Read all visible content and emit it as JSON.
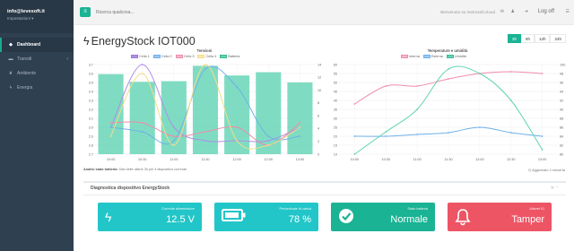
{
  "sidebar": {
    "profile_email": "info@levesoft.it",
    "profile_role": "Impostazioni ▾",
    "items": [
      {
        "label": "Dashboard",
        "icon": "dashboard-icon"
      },
      {
        "label": "Transiti",
        "icon": "car-icon"
      },
      {
        "label": "Ambiente",
        "icon": "leaf-icon"
      },
      {
        "label": "Energia",
        "icon": "bolt-icon"
      }
    ]
  },
  "topbar": {
    "search_placeholder": "Ricerca qualcosa...",
    "welcome": "Benvenuto su metrosoft.cloud",
    "logoff": "Log off"
  },
  "page": {
    "title": "EnergyStock IOT000",
    "ranges": [
      "3h",
      "6h",
      "12h",
      "24h"
    ],
    "active_range": "3h"
  },
  "footnote": {
    "label": "Analisi stato batteria:",
    "text": "Dati delle ultime 3h per il dispositivo corrente."
  },
  "updated": "Aggiornato 2 minuti fa",
  "diagnostics": {
    "title": "Diagnostica dispositivo EnergyStock",
    "tiles": [
      {
        "label": "Corrente alimentatore",
        "value": "12.5 V",
        "icon": "bolt-icon",
        "color": "#23c6c8"
      },
      {
        "label": "Percentuale di carica",
        "value": "78 %",
        "icon": "battery-icon",
        "color": "#23c6c8"
      },
      {
        "label": "Stato batteria",
        "value": "Normale",
        "icon": "check-circle-icon",
        "color": "#1ab394"
      },
      {
        "label": "Allarmi IO",
        "value": "Tamper",
        "icon": "bell-icon",
        "color": "#ed5565"
      }
    ]
  },
  "chart_data": [
    {
      "type": "bar",
      "title": "Tensioni",
      "categories": [
        "10:00",
        "10:30",
        "11:00",
        "11:30",
        "12:00",
        "12:30",
        "13:00"
      ],
      "ylim": [
        2.7,
        3.7
      ],
      "y2lim": [
        0,
        14
      ],
      "yticks": [
        "2.7",
        "2.8",
        "2.9",
        "3.0",
        "3.1",
        "3.2",
        "3.3",
        "3.4",
        "3.5",
        "3.6",
        "3.7"
      ],
      "y2ticks": [
        "0",
        "2",
        "4",
        "6",
        "8",
        "10",
        "12",
        "14"
      ],
      "bars": {
        "name": "Batteria",
        "values": [
          12.5,
          11.3,
          11.4,
          13.8,
          12.3,
          12.8,
          11.2
        ],
        "color": "#5fd3b3"
      },
      "series": [
        {
          "name": "Cella 1",
          "values": [
            3.0,
            3.7,
            3.0,
            2.85,
            2.85,
            2.85,
            3.0
          ],
          "color": "#b18ee6"
        },
        {
          "name": "Cella 2",
          "values": [
            3.0,
            2.95,
            2.85,
            3.65,
            3.45,
            2.9,
            2.9
          ],
          "color": "#6fb0ea"
        },
        {
          "name": "Cella 3",
          "values": [
            3.05,
            3.05,
            2.9,
            2.95,
            3.0,
            2.8,
            3.05
          ],
          "color": "#f08ca8"
        },
        {
          "name": "Cella 4",
          "values": [
            2.9,
            3.6,
            2.8,
            3.7,
            2.85,
            2.8,
            3.0
          ],
          "color": "#f5dc8a"
        }
      ]
    },
    {
      "type": "line",
      "title": "Temperature e umidità",
      "categories": [
        "10:00",
        "10:30",
        "11:00",
        "11:30",
        "12:00",
        "12:30",
        "13:00"
      ],
      "ylim": [
        10,
        60
      ],
      "y2lim": [
        80,
        100
      ],
      "yticks": [
        "10",
        "15",
        "20",
        "25",
        "30",
        "35",
        "40",
        "45",
        "50",
        "55",
        "60"
      ],
      "y2ticks": [
        "80",
        "82",
        "84",
        "86",
        "88",
        "90",
        "92",
        "94",
        "96",
        "98",
        "100"
      ],
      "series": [
        {
          "name": "Interna",
          "values": [
            38,
            48,
            48,
            52,
            55,
            56,
            55
          ],
          "color": "#f08ca8",
          "axis": "left"
        },
        {
          "name": "Esterna",
          "values": [
            20,
            20,
            21,
            22,
            25,
            22,
            20
          ],
          "color": "#6fb0ea",
          "axis": "left"
        },
        {
          "name": "Umidità",
          "values": [
            80,
            85,
            90,
            99,
            98,
            92,
            81
          ],
          "color": "#5fd3b3",
          "axis": "right"
        }
      ]
    }
  ]
}
